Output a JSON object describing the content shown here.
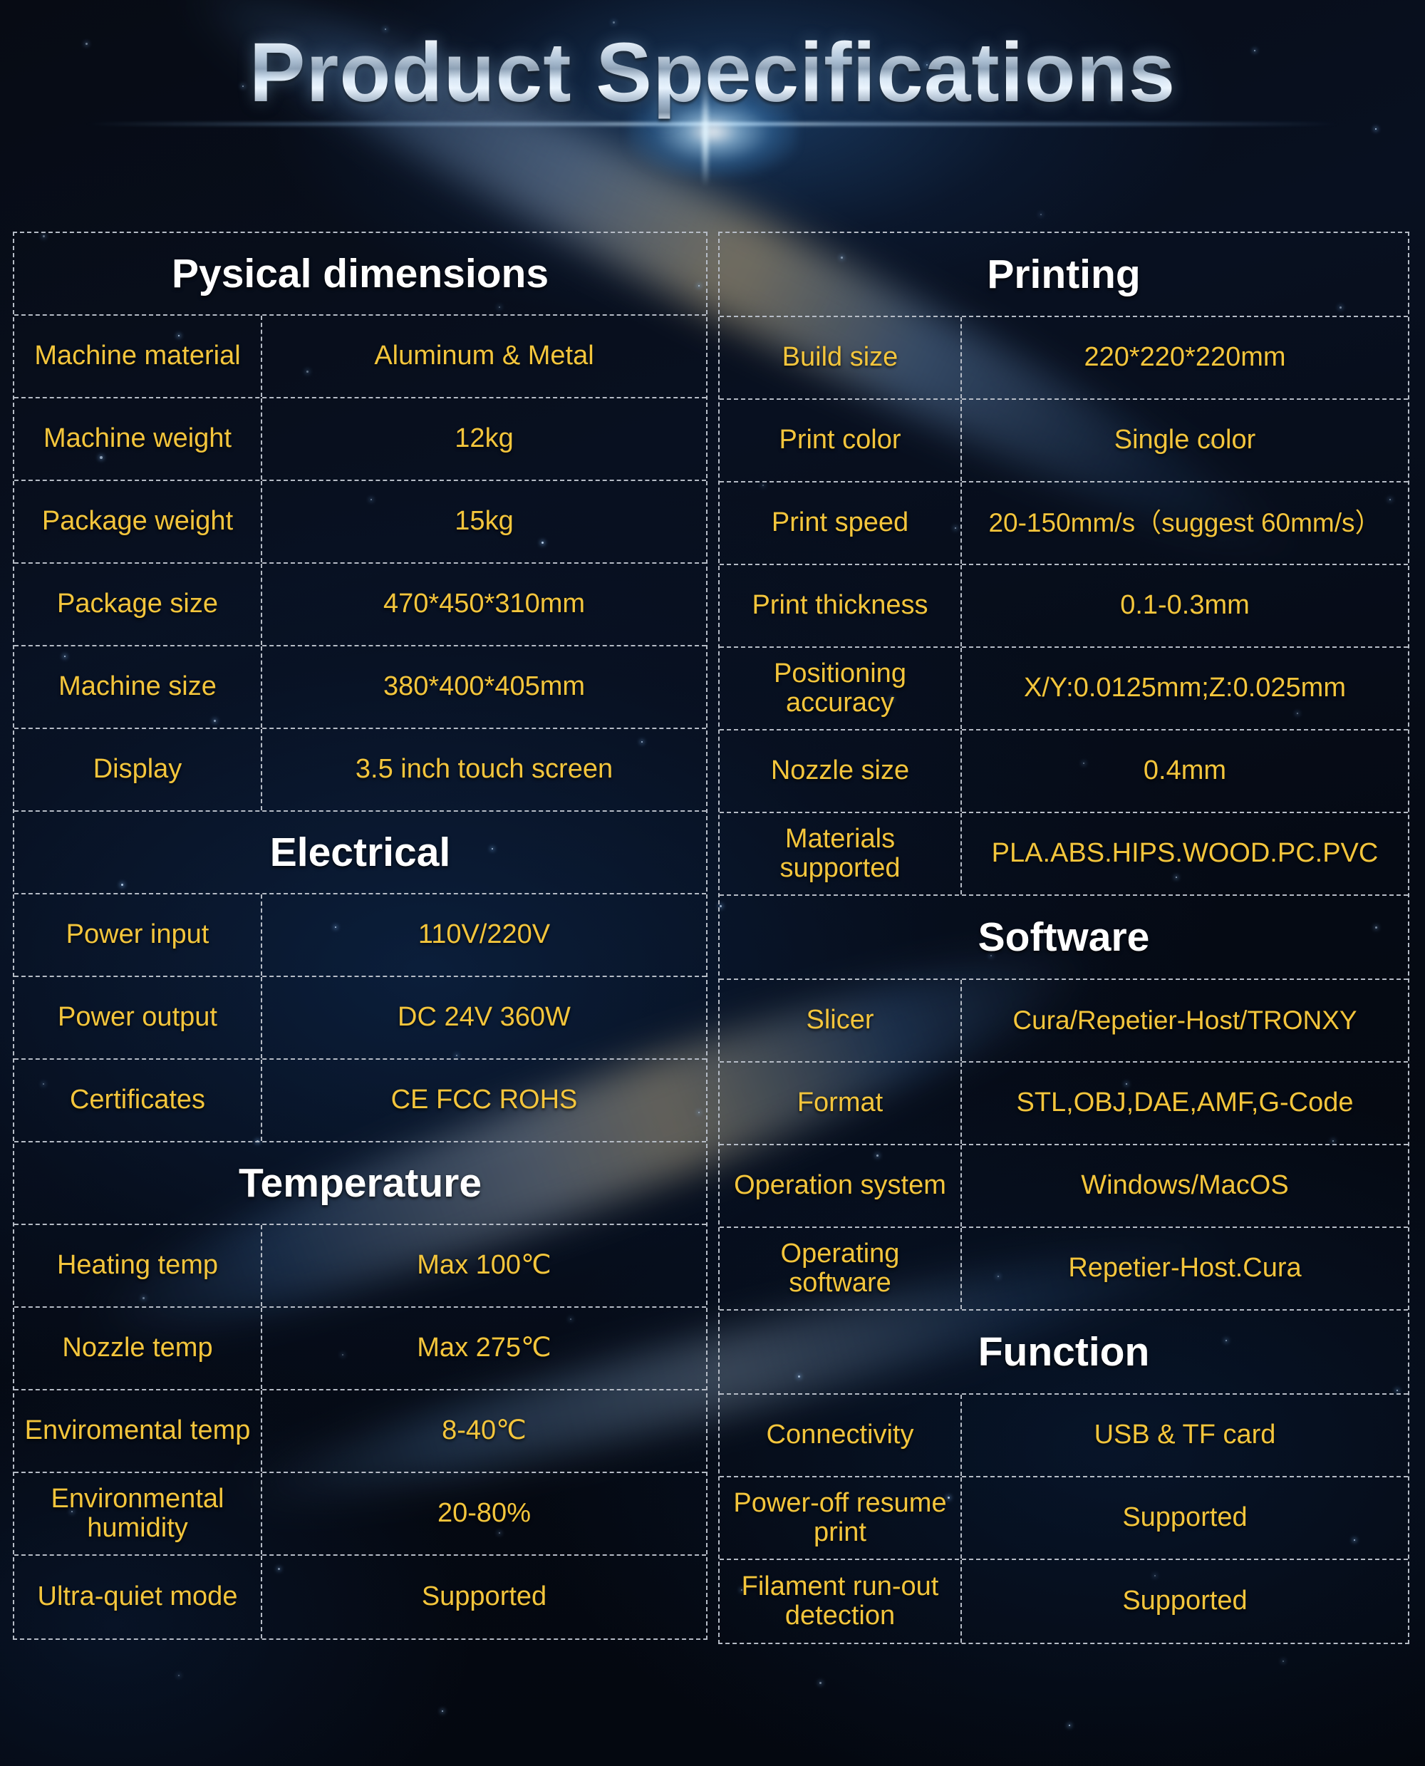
{
  "title": "Product Specifications",
  "colors": {
    "value_text": "#f3c53c",
    "header_text": "#ffffff",
    "grid_line": "#b6bcc6",
    "background": "#05070e"
  },
  "left_column": [
    {
      "section": "Pysical dimensions",
      "rows": [
        {
          "key": "Machine material",
          "value": "Aluminum & Metal"
        },
        {
          "key": "Machine weight",
          "value": "12kg"
        },
        {
          "key": "Package weight",
          "value": "15kg"
        },
        {
          "key": "Package size",
          "value": "470*450*310mm"
        },
        {
          "key": "Machine size",
          "value": "380*400*405mm"
        },
        {
          "key": "Display",
          "value": "3.5 inch touch screen"
        }
      ]
    },
    {
      "section": "Electrical",
      "rows": [
        {
          "key": "Power input",
          "value": "110V/220V"
        },
        {
          "key": "Power output",
          "value": "DC  24V  360W"
        },
        {
          "key": "Certificates",
          "value": "CE  FCC ROHS"
        }
      ]
    },
    {
      "section": "Temperature",
      "rows": [
        {
          "key": "Heating temp",
          "value": "Max 100℃"
        },
        {
          "key": "Nozzle temp",
          "value": "Max 275℃"
        },
        {
          "key": "Enviromental temp",
          "value": "8-40℃"
        },
        {
          "key": "Environmental humidity",
          "value": "20-80%"
        },
        {
          "key": "Ultra-quiet mode",
          "value": "Supported"
        }
      ]
    }
  ],
  "right_column": [
    {
      "section": "Printing",
      "rows": [
        {
          "key": "Build size",
          "value": "220*220*220mm"
        },
        {
          "key": "Print color",
          "value": "Single color"
        },
        {
          "key": "Print speed",
          "value": "20-150mm/s（suggest 60mm/s）"
        },
        {
          "key": "Print thickness",
          "value": "0.1-0.3mm"
        },
        {
          "key": "Positioning accuracy",
          "value": "X/Y:0.0125mm;Z:0.025mm"
        },
        {
          "key": "Nozzle size",
          "value": "0.4mm"
        },
        {
          "key": "Materials supported",
          "value": "PLA.ABS.HIPS.WOOD.PC.PVC"
        }
      ]
    },
    {
      "section": "Software",
      "rows": [
        {
          "key": "Slicer",
          "value": "Cura/Repetier-Host/TRONXY"
        },
        {
          "key": "Format",
          "value": "STL,OBJ,DAE,AMF,G-Code"
        },
        {
          "key": "Operation system",
          "value": "Windows/MacOS"
        },
        {
          "key": "Operating software",
          "value": "Repetier-Host.Cura"
        }
      ]
    },
    {
      "section": "Function",
      "rows": [
        {
          "key": "Connectivity",
          "value": "USB & TF card"
        },
        {
          "key": "Power-off resume print",
          "value": "Supported"
        },
        {
          "key": "Filament run-out detection",
          "value": "Supported"
        }
      ]
    }
  ]
}
